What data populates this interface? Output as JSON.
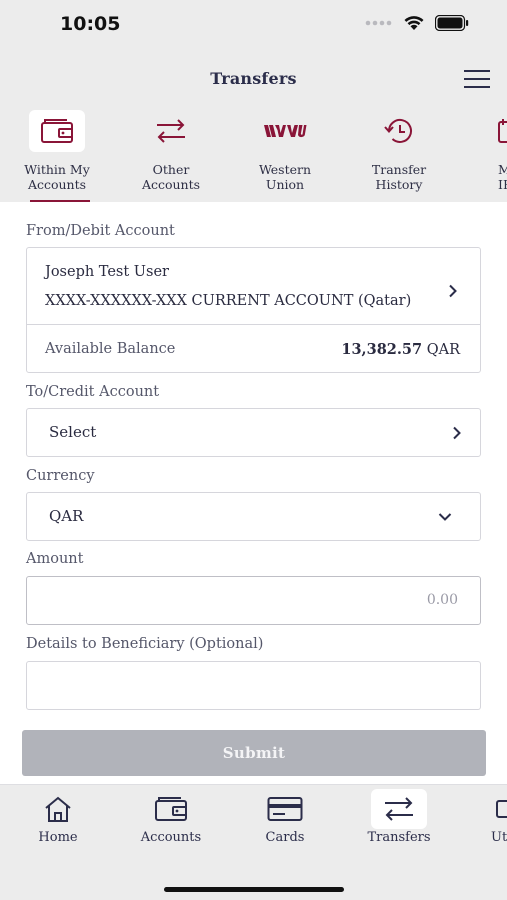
{
  "status": {
    "time": "10:05",
    "signal_icon": "signal-dots-icon",
    "wifi_icon": "wifi-icon",
    "battery_icon": "battery-icon"
  },
  "header": {
    "title": "Transfers",
    "menu_icon": "hamburger-menu-icon"
  },
  "tabs": [
    {
      "label": "Within My\nAccounts",
      "icon": "wallet-icon",
      "active": true
    },
    {
      "label": "Other\nAccounts",
      "icon": "swap-arrows-icon"
    },
    {
      "label": "Western\nUnion",
      "icon": "western-union-logo"
    },
    {
      "label": "Transfer\nHistory",
      "icon": "history-clock-icon"
    },
    {
      "label": "M\nIB",
      "icon": "calendar-icon"
    }
  ],
  "form": {
    "from_label": "From/Debit Account",
    "from_account": {
      "name": "Joseph Test User",
      "number": "XXXX-XXXXXX-XXX CURRENT ACCOUNT (Qatar)",
      "balance_label": "Available Balance",
      "balance_value": "13,382.57",
      "balance_currency": "QAR"
    },
    "to_label": "To/Credit Account",
    "to_value": "Select",
    "currency_label": "Currency",
    "currency_value": "QAR",
    "amount_label": "Amount",
    "amount_placeholder": "0.00",
    "details_label": "Details to Beneficiary (Optional)",
    "details_placeholder": "",
    "submit_label": "Submit"
  },
  "bottom_nav": [
    {
      "label": "Home",
      "icon": "home-icon"
    },
    {
      "label": "Accounts",
      "icon": "wallet-icon"
    },
    {
      "label": "Cards",
      "icon": "card-icon"
    },
    {
      "label": "Transfers",
      "icon": "transfer-arrows-icon",
      "active": true
    },
    {
      "label": "Ut",
      "icon": "utilities-icon"
    }
  ],
  "colors": {
    "accent": "#8a1538",
    "navy": "#2b2d4a",
    "submit_disabled": "#b1b3ba"
  }
}
